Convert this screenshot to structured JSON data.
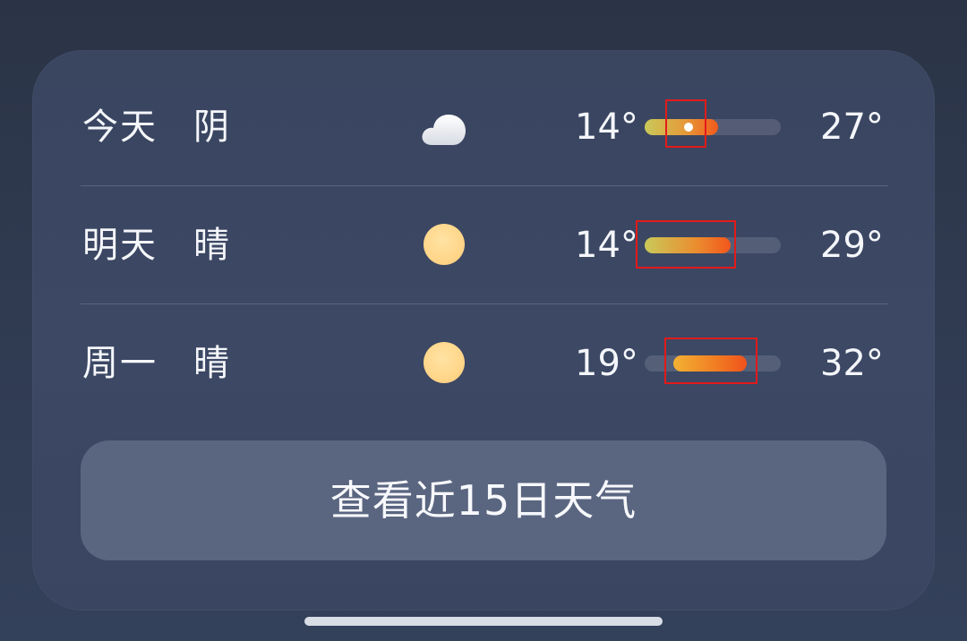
{
  "forecast": {
    "rows": [
      {
        "day": "今天",
        "condition": "阴",
        "icon": "cloud-icon",
        "low": "14°",
        "high": "27°",
        "range_start": 0.0,
        "range_end": 0.54,
        "current_marker": 0.32
      },
      {
        "day": "明天",
        "condition": "晴",
        "icon": "sun-icon",
        "low": "14°",
        "high": "29°",
        "range_start": 0.0,
        "range_end": 0.63
      },
      {
        "day": "周一",
        "condition": "晴",
        "icon": "sun-icon",
        "low": "19°",
        "high": "32°",
        "range_start": 0.21,
        "range_end": 0.75
      }
    ]
  },
  "button": {
    "label": "查看近15日天气"
  },
  "colors": {
    "background": "#2f3a50",
    "card": "#3c4864",
    "button": "#5a6580",
    "sun": "#ffd68a",
    "bar_hot": "#f15a1c",
    "bar_cool": "#c9c95a",
    "highlight_box": "#e21a1a"
  }
}
